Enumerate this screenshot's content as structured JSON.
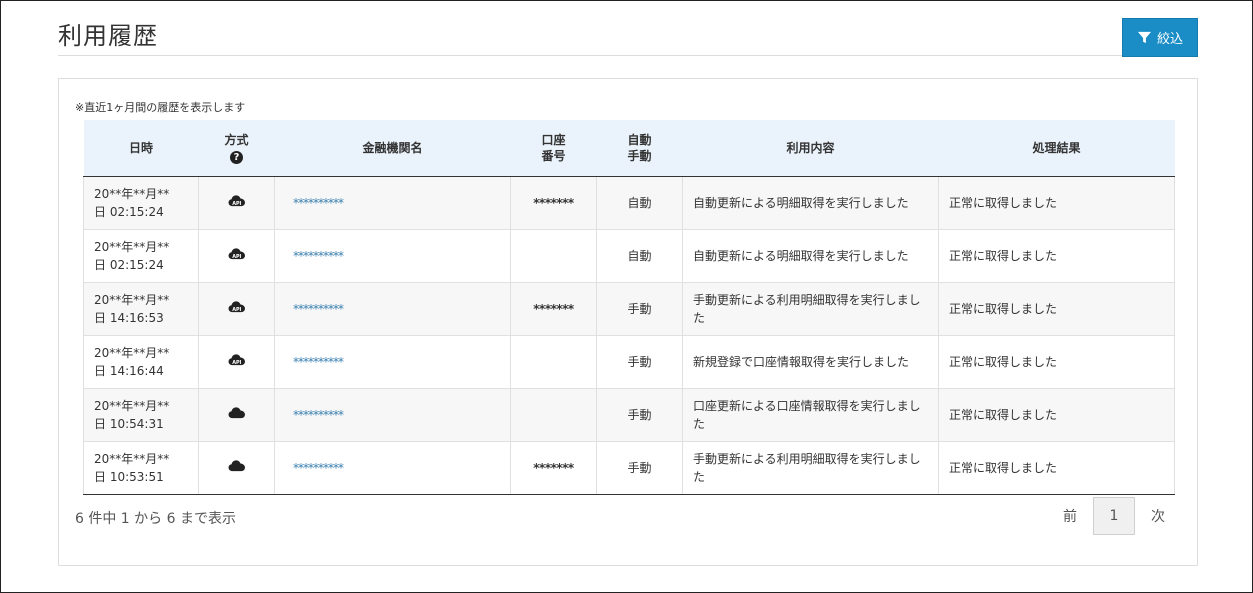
{
  "header": {
    "title": "利用履歴",
    "filter_label": "絞込"
  },
  "note": "※直近1ヶ月間の履歴を表示します",
  "table": {
    "columns": {
      "date": "日時",
      "method": "方式",
      "institution": "金融機関名",
      "account_l1": "口座",
      "account_l2": "番号",
      "mode_l1": "自動",
      "mode_l2": "手動",
      "detail": "利用内容",
      "result": "処理結果"
    },
    "rows": [
      {
        "date_l1": "20**年**月**",
        "date_l2": "日 02:15:24",
        "method_icon": "cloud-api-icon",
        "method_label": "API",
        "institution": "**********",
        "account": "*******",
        "mode": "自動",
        "detail": "自動更新による明細取得を実行しました",
        "result": "正常に取得しました"
      },
      {
        "date_l1": "20**年**月**",
        "date_l2": "日 02:15:24",
        "method_icon": "cloud-api-icon",
        "method_label": "API",
        "institution": "**********",
        "account": "",
        "mode": "自動",
        "detail": "自動更新による明細取得を実行しました",
        "result": "正常に取得しました"
      },
      {
        "date_l1": "20**年**月**",
        "date_l2": "日 14:16:53",
        "method_icon": "cloud-api-icon",
        "method_label": "API",
        "institution": "**********",
        "account": "*******",
        "mode": "手動",
        "detail": "手動更新による利用明細取得を実行しました",
        "result": "正常に取得しました"
      },
      {
        "date_l1": "20**年**月**",
        "date_l2": "日 14:16:44",
        "method_icon": "cloud-api-icon",
        "method_label": "API",
        "institution": "**********",
        "account": "",
        "mode": "手動",
        "detail": "新規登録で口座情報取得を実行しました",
        "result": "正常に取得しました"
      },
      {
        "date_l1": "20**年**月**",
        "date_l2": "日 10:54:31",
        "method_icon": "cloud-icon",
        "method_label": "",
        "institution": "**********",
        "account": "",
        "mode": "手動",
        "detail": "口座更新による口座情報取得を実行しました",
        "result": "正常に取得しました"
      },
      {
        "date_l1": "20**年**月**",
        "date_l2": "日 10:53:51",
        "method_icon": "cloud-icon",
        "method_label": "",
        "institution": "**********",
        "account": "*******",
        "mode": "手動",
        "detail": "手動更新による利用明細取得を実行しました",
        "result": "正常に取得しました"
      }
    ]
  },
  "footer": {
    "count_text": "6 件中 1 から 6 まで表示"
  },
  "pagination": {
    "prev": "前",
    "page": "1",
    "next": "次"
  },
  "colors": {
    "accent": "#1a8dc6",
    "header_bg": "#eaf3fb",
    "link": "#3a7fb0"
  }
}
